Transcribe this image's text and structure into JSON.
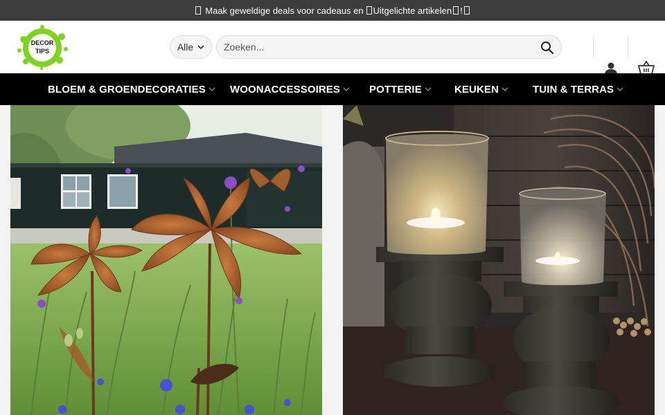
{
  "promo": {
    "text_part1": "Maak geweldige deals voor cadeaus en",
    "text_part2": "Uitgelichte artikelen",
    "text_part3": "!"
  },
  "logo": {
    "line1": "DECOR",
    "line2": "TIPS",
    "brand_color": "#7ed321"
  },
  "search": {
    "category_label": "Alle",
    "placeholder": "Zoeken...",
    "value": ""
  },
  "header_icons": [
    "user-icon",
    "basket-icon"
  ],
  "nav": {
    "items": [
      {
        "label": "BLOEM & GROENDECORATIES"
      },
      {
        "label": "WOONACCESSOIRES"
      },
      {
        "label": "POTTERIE"
      },
      {
        "label": "KEUKEN"
      },
      {
        "label": "TUIN & TERRAS"
      }
    ]
  },
  "hero": {
    "left_image": "rusty-metal-lily-garden-stakes-photo",
    "right_image": "glass-candle-holders-on-wooden-pedestals-photo"
  },
  "colors": {
    "topbar": "#3d3d3d",
    "nav": "#000000",
    "accent_green": "#7ed321"
  }
}
